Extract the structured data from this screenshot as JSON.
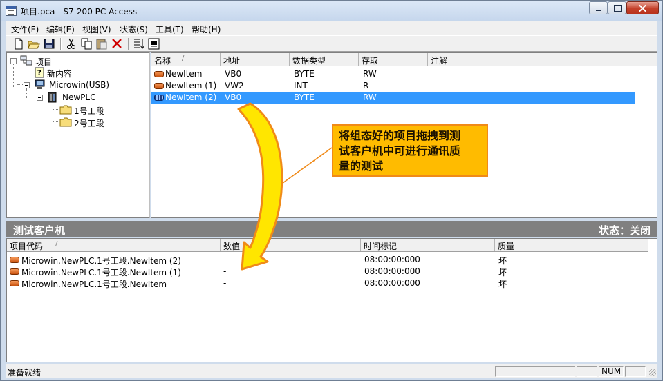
{
  "window": {
    "title": "项目.pca - S7-200 PC Access"
  },
  "menu": [
    "文件(F)",
    "编辑(E)",
    "视图(V)",
    "状态(S)",
    "工具(T)",
    "帮助(H)"
  ],
  "toolbar": {
    "icons": [
      "new-file-icon",
      "open-folder-icon",
      "save-icon",
      "cut-icon",
      "copy-icon",
      "paste-icon",
      "delete-icon",
      "add-to-client-icon",
      "client-view-icon"
    ]
  },
  "tree": {
    "root": "项目",
    "new_content": "新内容",
    "connection": "Microwin(USB)",
    "plc": "NewPLC",
    "folders": [
      "1号工段",
      "2号工段"
    ]
  },
  "item_list": {
    "headers": [
      "名称",
      "地址",
      "数据类型",
      "存取",
      "注解"
    ],
    "rows": [
      {
        "name": "NewItem",
        "address": "VB0",
        "type": "BYTE",
        "access": "RW",
        "note": ""
      },
      {
        "name": "NewItem (1)",
        "address": "VW2",
        "type": "INT",
        "access": "R",
        "note": ""
      },
      {
        "name": "NewItem (2)",
        "address": "VB0",
        "type": "BYTE",
        "access": "RW",
        "note": ""
      }
    ],
    "selected_index": 2
  },
  "test_client": {
    "title": "测试客户机",
    "status": "状态：关闭",
    "headers": [
      "项目代码",
      "数值",
      "时间标记",
      "质量"
    ],
    "rows": [
      {
        "code": "Microwin.NewPLC.1号工段.NewItem (2)",
        "value": "-",
        "timestamp": "08:00:00:000",
        "quality": "坏"
      },
      {
        "code": "Microwin.NewPLC.1号工段.NewItem (1)",
        "value": "-",
        "timestamp": "08:00:00:000",
        "quality": "坏"
      },
      {
        "code": "Microwin.NewPLC.1号工段.NewItem",
        "value": "-",
        "timestamp": "08:00:00:000",
        "quality": "坏"
      }
    ]
  },
  "statusbar": {
    "text": "准备就绪",
    "num": "NUM"
  },
  "annotation": {
    "line1": "将组态好的项目拖拽到测",
    "line2": "试客户机中可进行通讯质",
    "line3": "量的测试"
  },
  "colors": {
    "selection": "#3399ff",
    "callout_fill": "#ffbb00",
    "arrow_fill": "#ffe600",
    "arrow_outline": "#f08a18"
  }
}
